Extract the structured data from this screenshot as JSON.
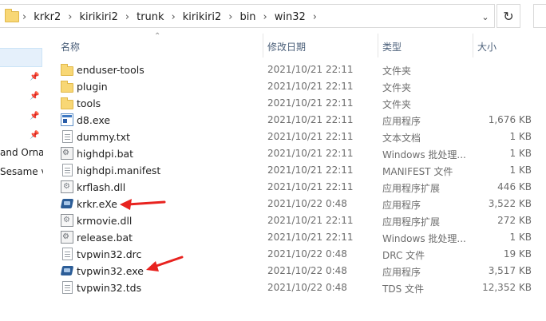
{
  "address_bar": {
    "breadcrumbs": [
      "krkr2",
      "kirikiri2",
      "trunk",
      "kirikiri2",
      "bin",
      "win32"
    ],
    "separator": "›",
    "dropdown_glyph": "⌄",
    "refresh_glyph": "↻"
  },
  "nav": {
    "pins": [
      "📌",
      "📌",
      "📌",
      "📌"
    ],
    "items": [
      "and Orna",
      "Sesame v"
    ]
  },
  "columns": {
    "name": "名称",
    "date": "修改日期",
    "type": "类型",
    "size": "大小"
  },
  "files": [
    {
      "name": "enduser-tools",
      "date": "2021/10/21 22:11",
      "type": "文件夹",
      "size": "",
      "icon": "folder-icon"
    },
    {
      "name": "plugin",
      "date": "2021/10/21 22:11",
      "type": "文件夹",
      "size": "",
      "icon": "folder-icon"
    },
    {
      "name": "tools",
      "date": "2021/10/21 22:11",
      "type": "文件夹",
      "size": "",
      "icon": "folder-icon"
    },
    {
      "name": "d8.exe",
      "date": "2021/10/21 22:11",
      "type": "应用程序",
      "size": "1,676 KB",
      "icon": "exe-icon"
    },
    {
      "name": "dummy.txt",
      "date": "2021/10/21 22:11",
      "type": "文本文档",
      "size": "1 KB",
      "icon": "text-file-icon"
    },
    {
      "name": "highdpi.bat",
      "date": "2021/10/21 22:11",
      "type": "Windows 批处理...",
      "size": "1 KB",
      "icon": "batch-file-icon"
    },
    {
      "name": "highdpi.manifest",
      "date": "2021/10/21 22:11",
      "type": "MANIFEST 文件",
      "size": "1 KB",
      "icon": "blank-file-icon"
    },
    {
      "name": "krflash.dll",
      "date": "2021/10/21 22:11",
      "type": "应用程序扩展",
      "size": "446 KB",
      "icon": "dll-icon"
    },
    {
      "name": "krkr.eXe",
      "date": "2021/10/22 0:48",
      "type": "应用程序",
      "size": "3,522 KB",
      "icon": "kirikiri-app-icon"
    },
    {
      "name": "krmovie.dll",
      "date": "2021/10/21 22:11",
      "type": "应用程序扩展",
      "size": "272 KB",
      "icon": "dll-icon"
    },
    {
      "name": "release.bat",
      "date": "2021/10/21 22:11",
      "type": "Windows 批处理...",
      "size": "1 KB",
      "icon": "batch-file-icon"
    },
    {
      "name": "tvpwin32.drc",
      "date": "2021/10/22 0:48",
      "type": "DRC 文件",
      "size": "19 KB",
      "icon": "blank-file-icon"
    },
    {
      "name": "tvpwin32.exe",
      "date": "2021/10/22 0:48",
      "type": "应用程序",
      "size": "3,517 KB",
      "icon": "kirikiri-app-icon"
    },
    {
      "name": "tvpwin32.tds",
      "date": "2021/10/22 0:48",
      "type": "TDS 文件",
      "size": "12,352 KB",
      "icon": "blank-file-icon"
    }
  ],
  "annotations": {
    "arrow_color": "#e8231f"
  }
}
